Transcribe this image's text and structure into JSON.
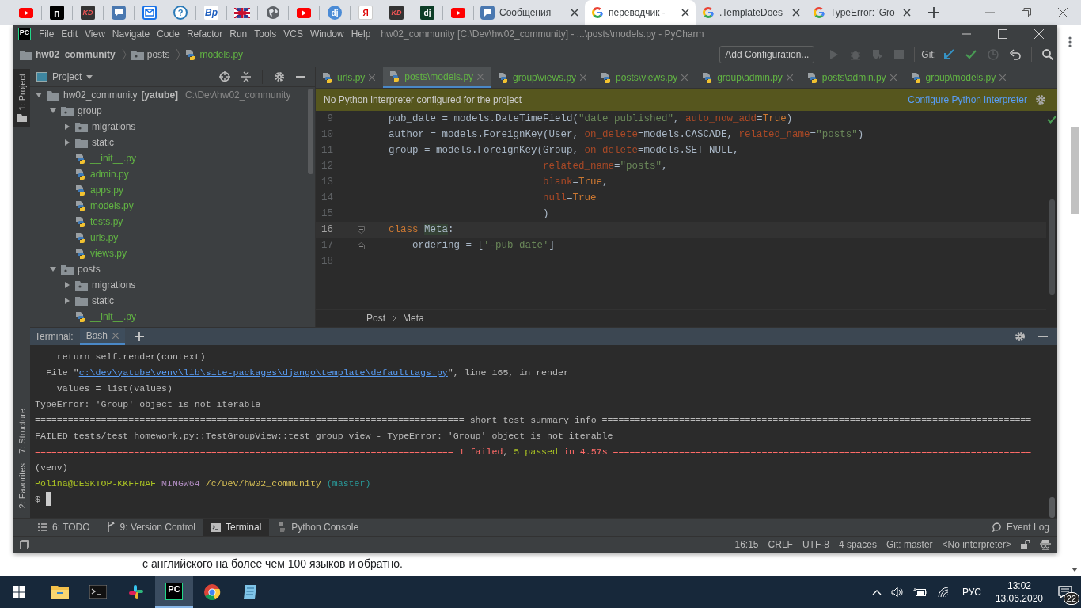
{
  "browser": {
    "pinned_tabs": [
      {
        "kind": "youtube"
      },
      {
        "kind": "black",
        "label": "п"
      },
      {
        "kind": "kd",
        "label": "KD"
      },
      {
        "kind": "chat"
      },
      {
        "kind": "mail"
      },
      {
        "kind": "help",
        "label": "?"
      },
      {
        "kind": "bp",
        "label": "Bp"
      },
      {
        "kind": "flag"
      },
      {
        "kind": "globe"
      },
      {
        "kind": "youtube"
      },
      {
        "kind": "djround",
        "label": "dj"
      },
      {
        "kind": "ya",
        "label": "Я"
      },
      {
        "kind": "kd",
        "label": "KD"
      },
      {
        "kind": "djsquare",
        "label": "dj"
      },
      {
        "kind": "youtube"
      }
    ],
    "tabs": [
      {
        "kind": "chat",
        "title": "Сообщения",
        "selected": false
      },
      {
        "kind": "google",
        "title": "переводчик -",
        "selected": true
      },
      {
        "kind": "google",
        "title": ".TemplateDoes",
        "selected": false
      },
      {
        "kind": "google",
        "title": "TypeError: 'Gro",
        "selected": false
      }
    ],
    "page_text": "с английского на более чем 100 языков и обратно."
  },
  "ide": {
    "logo": "PC",
    "menu": [
      "File",
      "Edit",
      "View",
      "Navigate",
      "Code",
      "Refactor",
      "Run",
      "Tools",
      "VCS",
      "Window",
      "Help"
    ],
    "title": "hw02_community [C:\\Dev\\hw02_community] - ...\\posts\\models.py - PyCharm",
    "breadcrumbs": [
      {
        "label": "hw02_community",
        "kind": "root"
      },
      {
        "label": "posts",
        "kind": "folder"
      },
      {
        "label": "models.py",
        "kind": "file"
      }
    ],
    "run_config": "Add Configuration...",
    "vcs_label": "Git:",
    "stripe": {
      "top": [
        {
          "label": "1: Project",
          "selected": true
        }
      ],
      "bottom": [
        {
          "label": "7: Structure",
          "selected": false
        },
        {
          "label": "2: Favorites",
          "selected": false
        }
      ]
    },
    "project": {
      "title": "Project",
      "tree": [
        {
          "name": "hw02_community",
          "tag": "[yatube]",
          "path": "C:\\Dev\\hw02_community",
          "kind": "folder",
          "expanded": true,
          "children": [
            {
              "name": "group",
              "kind": "package",
              "expanded": true,
              "children": [
                {
                  "name": "migrations",
                  "kind": "package",
                  "expanded": false
                },
                {
                  "name": "static",
                  "kind": "folder",
                  "expanded": false
                },
                {
                  "name": "__init__.py",
                  "kind": "python"
                },
                {
                  "name": "admin.py",
                  "kind": "python"
                },
                {
                  "name": "apps.py",
                  "kind": "python"
                },
                {
                  "name": "models.py",
                  "kind": "python"
                },
                {
                  "name": "tests.py",
                  "kind": "python"
                },
                {
                  "name": "urls.py",
                  "kind": "python"
                },
                {
                  "name": "views.py",
                  "kind": "python"
                }
              ]
            },
            {
              "name": "posts",
              "kind": "package",
              "expanded": true,
              "children": [
                {
                  "name": "migrations",
                  "kind": "package",
                  "expanded": false
                },
                {
                  "name": "static",
                  "kind": "folder",
                  "expanded": false
                },
                {
                  "name": "__init__.py",
                  "kind": "python"
                }
              ]
            }
          ]
        }
      ]
    },
    "editor_tabs": [
      {
        "label": "urls.py",
        "selected": false
      },
      {
        "label": "posts\\models.py",
        "selected": true
      },
      {
        "label": "group\\views.py",
        "selected": false
      },
      {
        "label": "posts\\views.py",
        "selected": false
      },
      {
        "label": "group\\admin.py",
        "selected": false
      },
      {
        "label": "posts\\admin.py",
        "selected": false
      },
      {
        "label": "group\\models.py",
        "selected": false
      }
    ],
    "banner": {
      "text": "No Python interpreter configured for the project",
      "action": "Configure Python interpreter"
    },
    "code": [
      {
        "number": "9",
        "kind": "plain",
        "current": false,
        "tokens": [
          {
            "t": "    pub_date = models.DateTimeField(",
            "kind": "plain"
          },
          {
            "t": "\"date published\"",
            "kind": "str"
          },
          {
            "t": ", ",
            "kind": "plain"
          },
          {
            "t": "auto_now_add",
            "kind": "param"
          },
          {
            "t": "=",
            "kind": "plain"
          },
          {
            "t": "True",
            "kind": "kw"
          },
          {
            "t": ")",
            "kind": "plain"
          }
        ]
      },
      {
        "number": "10",
        "kind": "plain",
        "current": false,
        "tokens": [
          {
            "t": "    author = models.ForeignKey(User, ",
            "kind": "plain"
          },
          {
            "t": "on_delete",
            "kind": "param"
          },
          {
            "t": "=models.CASCADE, ",
            "kind": "plain"
          },
          {
            "t": "related_name",
            "kind": "param"
          },
          {
            "t": "=",
            "kind": "plain"
          },
          {
            "t": "\"posts\"",
            "kind": "str"
          },
          {
            "t": ")",
            "kind": "plain"
          }
        ]
      },
      {
        "number": "11",
        "kind": "plain",
        "current": false,
        "tokens": [
          {
            "t": "    group = models.ForeignKey(Group, ",
            "kind": "plain"
          },
          {
            "t": "on_delete",
            "kind": "param"
          },
          {
            "t": "=models.SET_NULL,",
            "kind": "plain"
          }
        ]
      },
      {
        "number": "12",
        "kind": "plain",
        "current": false,
        "tokens": [
          {
            "t": "                              related_name",
            "kind": "param"
          },
          {
            "t": "=",
            "kind": "plain"
          },
          {
            "t": "\"posts\"",
            "kind": "str"
          },
          {
            "t": ",",
            "kind": "plain"
          }
        ]
      },
      {
        "number": "13",
        "kind": "plain",
        "current": false,
        "tokens": [
          {
            "t": "                              blank",
            "kind": "param"
          },
          {
            "t": "=",
            "kind": "plain"
          },
          {
            "t": "True",
            "kind": "kw"
          },
          {
            "t": ",",
            "kind": "plain"
          }
        ]
      },
      {
        "number": "14",
        "kind": "plain",
        "current": false,
        "tokens": [
          {
            "t": "                              null",
            "kind": "param"
          },
          {
            "t": "=",
            "kind": "plain"
          },
          {
            "t": "True",
            "kind": "kw"
          }
        ]
      },
      {
        "number": "15",
        "kind": "plain",
        "current": false,
        "tokens": [
          {
            "t": "                              )",
            "kind": "plain"
          }
        ]
      },
      {
        "number": "16",
        "kind": "foldstart",
        "current": true,
        "tokens": [
          {
            "t": "    class ",
            "kind": "kw"
          },
          {
            "t": "Meta",
            "kind": "hl"
          },
          {
            "t": ":",
            "kind": "plain"
          }
        ]
      },
      {
        "number": "17",
        "kind": "foldend",
        "current": false,
        "tokens": [
          {
            "t": "        ordering = [",
            "kind": "plain"
          },
          {
            "t": "'-pub_date'",
            "kind": "str"
          },
          {
            "t": "]",
            "kind": "plain"
          }
        ]
      },
      {
        "number": "18",
        "kind": "plain",
        "current": false
      }
    ],
    "code_breadcrumbs": [
      "Post",
      "Meta"
    ],
    "terminal": {
      "label": "Terminal:",
      "tabs": [
        {
          "label": "Bash",
          "selected": true
        }
      ],
      "lines": [
        {
          "tokens": [
            {
              "t": "    return self.render(context)",
              "kind": "plain"
            }
          ]
        },
        {
          "tokens": [
            {
              "t": "  File \"",
              "kind": "plain"
            },
            {
              "t": "c:\\dev\\yatube\\venv\\lib\\site-packages\\django\\template\\defaulttags.py",
              "kind": "link"
            },
            {
              "t": "\", line 165, in render",
              "kind": "plain"
            }
          ]
        },
        {
          "tokens": [
            {
              "t": "    values = list(values)",
              "kind": "plain"
            }
          ]
        },
        {
          "tokens": [
            {
              "t": "TypeError: 'Group' object is not iterable",
              "kind": "plain"
            }
          ]
        },
        {
          "tokens": [
            {
              "t": "============================================================================== short test summary info ==============================================================================",
              "kind": "plain"
            }
          ]
        },
        {
          "tokens": [
            {
              "t": "FAILED tests/test_homework.py::TestGroupView::test_group_view - TypeError: 'Group' object is not iterable",
              "kind": "plain"
            }
          ]
        },
        {
          "tokens": [
            {
              "t": "============================================================================ ",
              "kind": "red"
            },
            {
              "t": "1 failed",
              "kind": "red"
            },
            {
              "t": ", ",
              "kind": "plain"
            },
            {
              "t": "5 passed",
              "kind": "green"
            },
            {
              "t": " in 4.57s ============================================================================",
              "kind": "red"
            }
          ]
        },
        {
          "tokens": [
            {
              "t": "(venv)",
              "kind": "plain"
            }
          ]
        },
        {
          "tokens": [
            {
              "t": "Polina@DESKTOP-KKFFNAF ",
              "kind": "green"
            },
            {
              "t": "MINGW64 ",
              "kind": "purple"
            },
            {
              "t": "/c/Dev/hw02_community ",
              "kind": "yellow"
            },
            {
              "t": "(master)",
              "kind": "cyan"
            }
          ]
        },
        {
          "tokens": [
            {
              "t": "$ ",
              "kind": "plain"
            }
          ],
          "cursor": true
        }
      ]
    },
    "tool_windows": [
      {
        "label": "6: TODO",
        "kind": "list",
        "selected": false
      },
      {
        "label": "9: Version Control",
        "kind": "vcs",
        "selected": false
      },
      {
        "label": "Terminal",
        "kind": "terminal",
        "selected": true
      },
      {
        "label": "Python Console",
        "kind": "python",
        "selected": false
      }
    ],
    "event_log": "Event Log",
    "status": [
      "16:15",
      "CRLF",
      "UTF-8",
      "4 spaces",
      "Git: master",
      "<No interpreter>"
    ]
  },
  "taskbar": {
    "apps": [
      {
        "kind": "explorer",
        "active": false
      },
      {
        "kind": "terminal",
        "active": false
      },
      {
        "kind": "slack",
        "active": false
      },
      {
        "kind": "pycharm",
        "label": "PC",
        "active": true
      },
      {
        "kind": "chrome",
        "active": false
      },
      {
        "kind": "notes",
        "active": false
      }
    ],
    "language": "РУС",
    "time": "13:02",
    "date": "13.06.2020",
    "notifications": "22"
  }
}
